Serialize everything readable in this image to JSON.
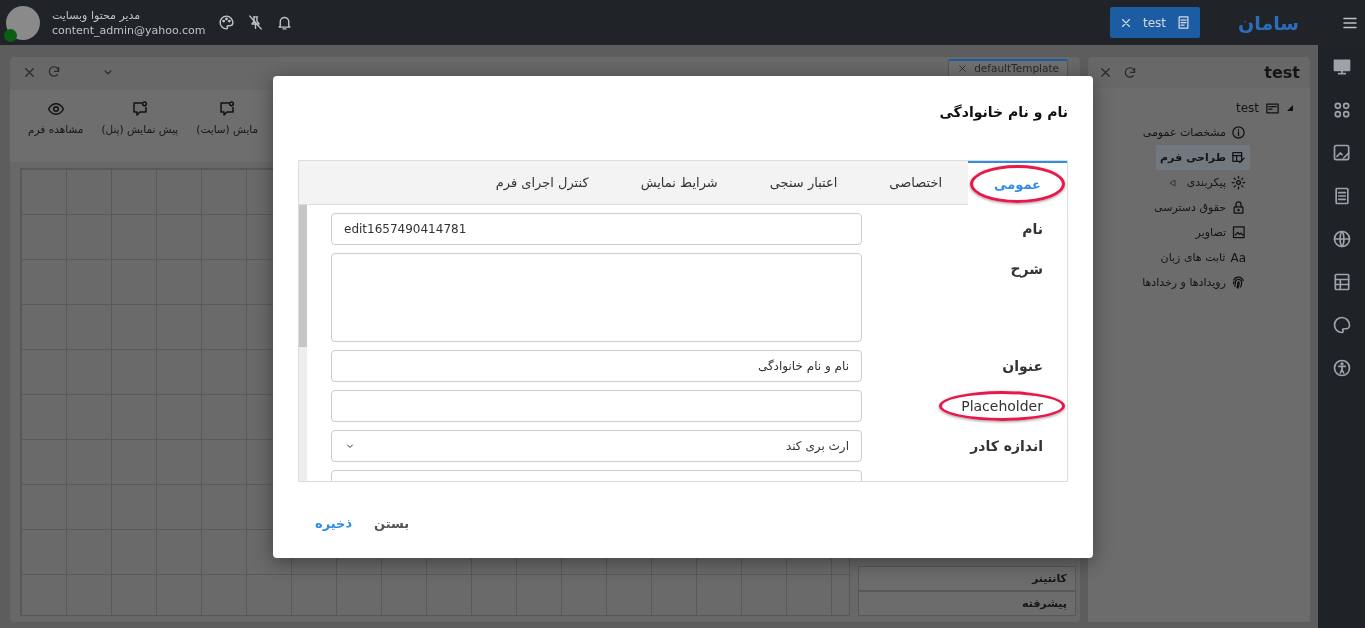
{
  "header": {
    "user_name": "مدیر محتوا وبسایت",
    "user_email": "content_admin@yahoo.com",
    "open_tab": "test",
    "logo": "سامان"
  },
  "designer": {
    "tab": "defaultTemplate",
    "toolbar": [
      {
        "label": "مایش (سایت)"
      },
      {
        "label": "پیش نمایش (پنل)"
      },
      {
        "label": "مشاهده فرم"
      }
    ],
    "properties": [
      {
        "label": "کانتینر"
      },
      {
        "label": "پیشرفته"
      }
    ]
  },
  "explorer": {
    "title": "test",
    "tree": [
      {
        "label": "test",
        "expanded": true,
        "children": [
          {
            "label": "مشخصات عمومی",
            "selected": false
          },
          {
            "label": "طراحی فرم",
            "selected": true
          },
          {
            "label": "پیکربندی",
            "selected": false,
            "expanded": false
          },
          {
            "label": "حقوق دسترسی",
            "selected": false
          },
          {
            "label": "تصاویر",
            "selected": false
          },
          {
            "label": "ثابت های زبان",
            "selected": false,
            "icon_text": "Aa"
          },
          {
            "label": "رویدادها و رخدادها",
            "selected": false
          }
        ]
      }
    ]
  },
  "dialog": {
    "title": "نام و نام خانوادگی",
    "tabs": [
      {
        "label": "عمومی",
        "selected": true,
        "highlighted": true
      },
      {
        "label": "اختصاصی",
        "selected": false,
        "highlighted": false
      },
      {
        "label": "اعتبار سنجی",
        "selected": false,
        "highlighted": false
      },
      {
        "label": "شرایط نمایش",
        "selected": false,
        "highlighted": false
      },
      {
        "label": "کنترل اجرای فرم",
        "selected": false,
        "highlighted": false
      }
    ],
    "fields": [
      {
        "kind": "text",
        "label": "نام",
        "value": "edit1657490414781",
        "highlighted": false
      },
      {
        "kind": "textarea",
        "label": "شرح",
        "highlighted": false
      },
      {
        "kind": "text",
        "label": "عنوان",
        "value": "نام و نام خانوادگی",
        "highlighted": false
      },
      {
        "kind": "text",
        "label": "Placeholder",
        "highlighted": true
      },
      {
        "kind": "select",
        "label": "اندازه کادر",
        "value": "ارث بری کند",
        "highlighted": false
      },
      {
        "kind": "text",
        "highlighted": false
      }
    ],
    "buttons": [
      {
        "label": "بستن",
        "kind": "secondary"
      },
      {
        "label": "ذخیره",
        "kind": "primary"
      }
    ]
  }
}
